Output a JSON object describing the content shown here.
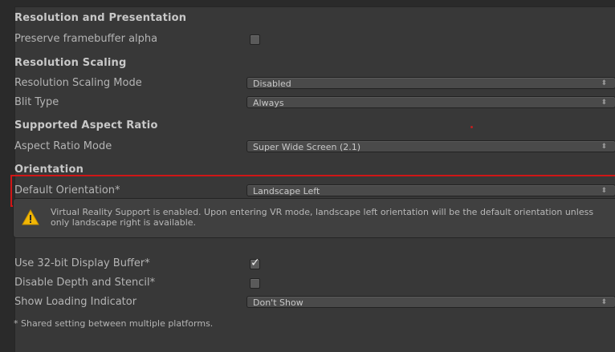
{
  "sections": {
    "resolution_presentation": "Resolution and Presentation",
    "resolution_scaling": "Resolution Scaling",
    "supported_aspect_ratio": "Supported Aspect Ratio",
    "orientation": "Orientation"
  },
  "settings": {
    "preserve_framebuffer_alpha": {
      "label": "Preserve framebuffer alpha",
      "checked": false
    },
    "resolution_scaling_mode": {
      "label": "Resolution Scaling Mode",
      "value": "Disabled"
    },
    "blit_type": {
      "label": "Blit Type",
      "value": "Always"
    },
    "aspect_ratio_mode": {
      "label": "Aspect Ratio Mode",
      "value": "Super Wide Screen (2.1)"
    },
    "default_orientation": {
      "label": "Default Orientation*",
      "value": "Landscape Left"
    },
    "use_32bit_display_buffer": {
      "label": "Use 32-bit Display Buffer*",
      "checked": true
    },
    "disable_depth_stencil": {
      "label": "Disable Depth and Stencil*",
      "checked": false
    },
    "show_loading_indicator": {
      "label": "Show Loading Indicator",
      "value": "Don't Show"
    }
  },
  "warning": {
    "icon": "warning-icon",
    "text": "Virtual Reality Support is enabled. Upon entering VR mode, landscape left orientation will be the default orientation unless only landscape right is available."
  },
  "footer": "* Shared setting between multiple platforms.",
  "colors": {
    "background": "#383838",
    "highlight": "#d01616",
    "warning": "#f2b705"
  }
}
